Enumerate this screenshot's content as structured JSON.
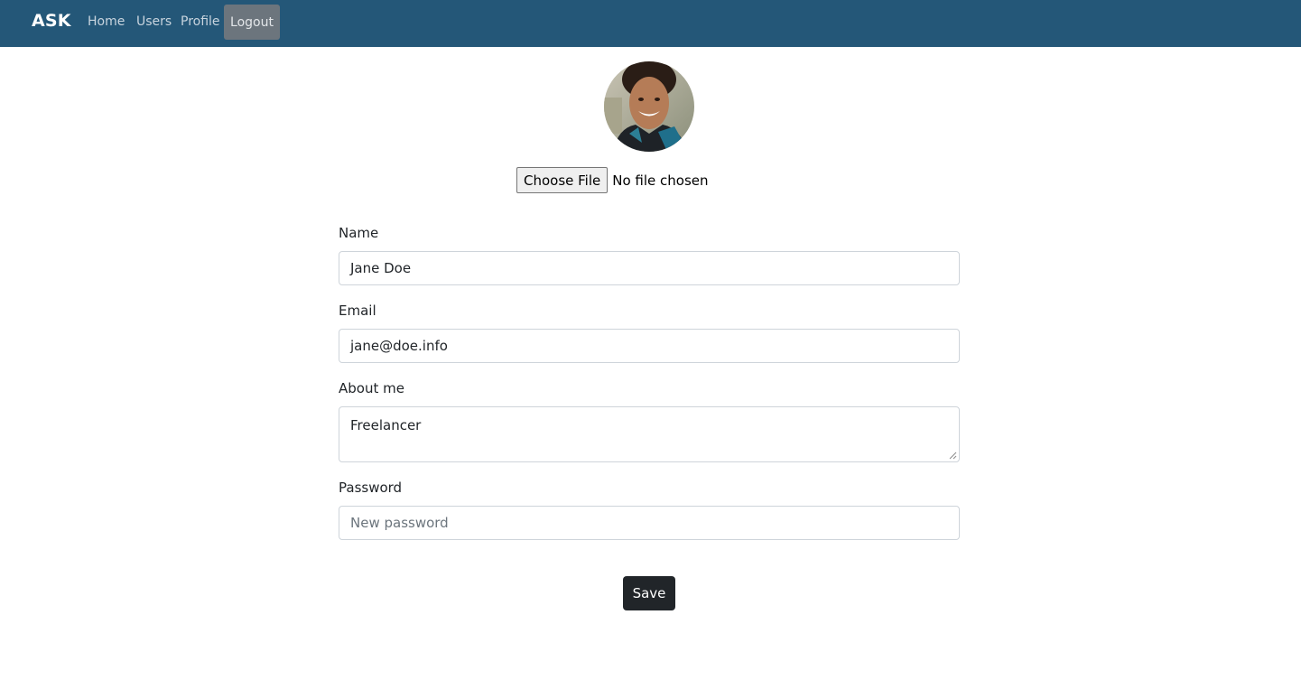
{
  "navbar": {
    "brand": "ASK",
    "links": [
      "Home",
      "Users",
      "Profile"
    ],
    "logout_label": "Logout",
    "background_color": "#245778"
  },
  "profile": {
    "avatar_icon": "user-avatar-photo",
    "file_input": {
      "button_label": "Choose File",
      "status_text": "No file chosen"
    }
  },
  "form": {
    "name_label": "Name",
    "name_value": "Jane Doe",
    "email_label": "Email",
    "email_value": "jane@doe.info",
    "about_label": "About me",
    "about_value": "Freelancer",
    "password_label": "Password",
    "password_placeholder": "New password",
    "save_label": "Save"
  }
}
